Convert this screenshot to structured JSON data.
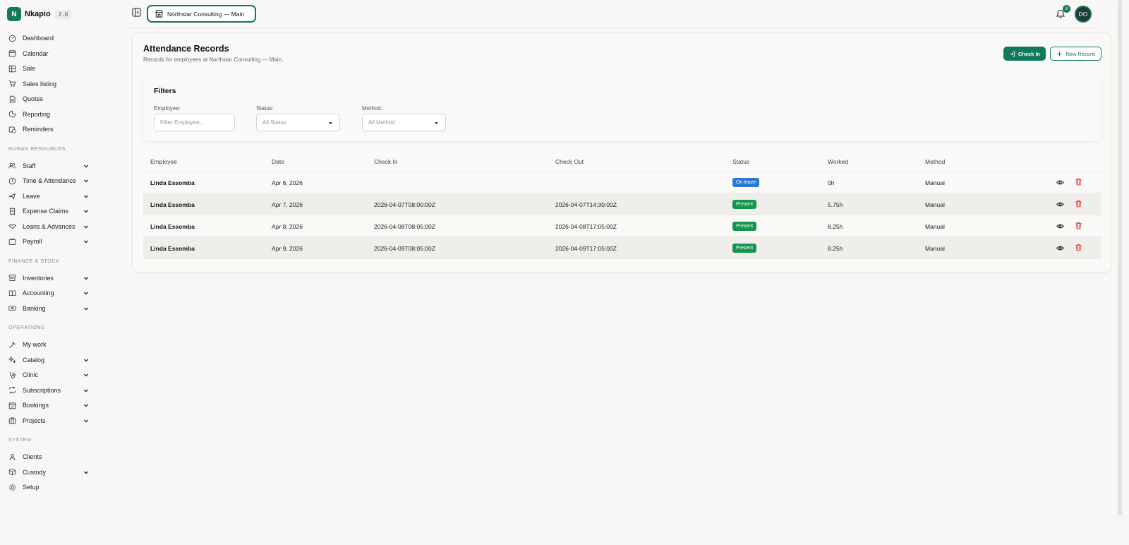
{
  "brand": {
    "logo_letter": "N",
    "name": "Nkapio",
    "version": "2.0",
    "accent": "#107a5a"
  },
  "sidebar": {
    "main_items": [
      {
        "label": "Dashboard",
        "icon": "dashboard-icon"
      },
      {
        "label": "Calendar",
        "icon": "calendar-icon"
      },
      {
        "label": "Sale",
        "icon": "sale-icon"
      },
      {
        "label": "Sales listing",
        "icon": "cart-icon"
      },
      {
        "label": "Quotes",
        "icon": "document-icon"
      },
      {
        "label": "Reporting",
        "icon": "pie-chart-icon"
      },
      {
        "label": "Reminders",
        "icon": "calendar-clock-icon"
      }
    ],
    "sections": [
      {
        "title": "HUMAN RESOURCES",
        "items": [
          {
            "label": "Staff",
            "icon": "users-icon",
            "expandable": true
          },
          {
            "label": "Time & Attendance",
            "icon": "clock-icon",
            "expandable": true
          },
          {
            "label": "Leave",
            "icon": "plane-icon",
            "expandable": true
          },
          {
            "label": "Expense Claims",
            "icon": "receipt-icon",
            "expandable": true
          },
          {
            "label": "Loans & Advances",
            "icon": "handshake-icon",
            "expandable": true
          },
          {
            "label": "Payroll",
            "icon": "wallet-icon",
            "expandable": true
          }
        ]
      },
      {
        "title": "FINANCE & STOCK",
        "items": [
          {
            "label": "Inventories",
            "icon": "archive-icon",
            "expandable": true
          },
          {
            "label": "Accounting",
            "icon": "book-icon",
            "expandable": true
          },
          {
            "label": "Banking",
            "icon": "banknote-icon",
            "expandable": true
          }
        ]
      },
      {
        "title": "OPERATIONS",
        "items": [
          {
            "label": "My work",
            "icon": "wrench-icon",
            "expandable": false
          },
          {
            "label": "Catalog",
            "icon": "sparkles-icon",
            "expandable": true
          },
          {
            "label": "Clinic",
            "icon": "stethoscope-icon",
            "expandable": true
          },
          {
            "label": "Subscriptions",
            "icon": "repeat-icon",
            "expandable": true
          },
          {
            "label": "Bookings",
            "icon": "calendar-check-icon",
            "expandable": true
          },
          {
            "label": "Projects",
            "icon": "briefcase-icon",
            "expandable": true
          }
        ]
      },
      {
        "title": "SYSTEM",
        "items": [
          {
            "label": "Clients",
            "icon": "user-icon",
            "expandable": false
          },
          {
            "label": "Custody",
            "icon": "box-icon",
            "expandable": true
          },
          {
            "label": "Setup",
            "icon": "gear-icon",
            "expandable": false
          }
        ]
      }
    ]
  },
  "topbar": {
    "branch": "Northstar Consulting — Main",
    "notifications": "8",
    "avatar_initials": "DO"
  },
  "page": {
    "title": "Attendance Records",
    "subtitle": "Records for employees at Northstar Consulting — Main.",
    "check_in_label": "Check In",
    "new_record_label": "New Record"
  },
  "filters": {
    "title": "Filters",
    "employee_label": "Employee:",
    "employee_placeholder": "Filter Employee...",
    "status_label": "Status:",
    "status_value": "All Status",
    "method_label": "Method:",
    "method_value": "All Method"
  },
  "table": {
    "headers": [
      "Employee",
      "Date",
      "Check In",
      "Check Out",
      "Status",
      "Worked",
      "Method"
    ],
    "rows": [
      {
        "employee": "Linda Essomba",
        "date": "Apr 6, 2026",
        "check_in": "",
        "check_out": "",
        "status": "On leave",
        "status_kind": "leave",
        "worked": "0h",
        "method": "Manual"
      },
      {
        "employee": "Linda Essomba",
        "date": "Apr 7, 2026",
        "check_in": "2026-04-07T08:00:00Z",
        "check_out": "2026-04-07T14:30:00Z",
        "status": "Present",
        "status_kind": "present",
        "worked": "5.75h",
        "method": "Manual"
      },
      {
        "employee": "Linda Essomba",
        "date": "Apr 8, 2026",
        "check_in": "2026-04-08T08:05:00Z",
        "check_out": "2026-04-08T17:05:00Z",
        "status": "Present",
        "status_kind": "present",
        "worked": "8.25h",
        "method": "Manual"
      },
      {
        "employee": "Linda Essomba",
        "date": "Apr 9, 2026",
        "check_in": "2026-04-09T08:05:00Z",
        "check_out": "2026-04-09T17:05:00Z",
        "status": "Present",
        "status_kind": "present",
        "worked": "8.25h",
        "method": "Manual"
      }
    ]
  }
}
